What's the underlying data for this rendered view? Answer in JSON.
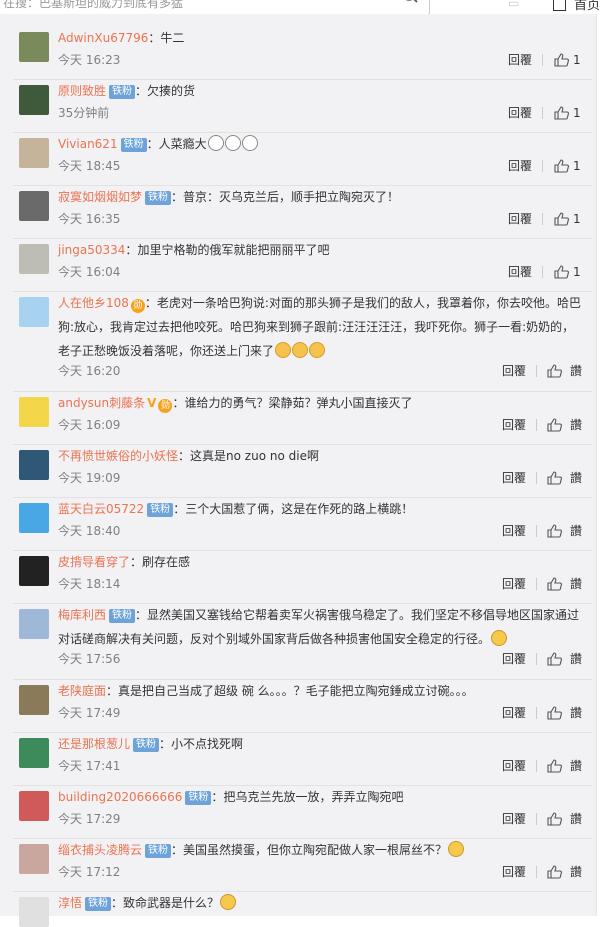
{
  "header": {
    "search_text": "在搜：巴基斯坦的威力到底有多猛",
    "home_label": "首页"
  },
  "comments": [
    {
      "name": "AdwinXu67796",
      "badge": "",
      "extra": "",
      "text": "牛二",
      "time": "今天 16:23",
      "reply": "回覆",
      "likes": "1",
      "avatar": "#7a8a5a"
    },
    {
      "name": "原则致胜",
      "badge": "铁粉",
      "extra": "",
      "text": "欠揍的货",
      "time": "35分钟前",
      "reply": "回覆",
      "likes": "1",
      "avatar": "#3e5a3a"
    },
    {
      "name": "Vivian621",
      "badge": "铁粉",
      "extra": "",
      "text": "人菜瘾大",
      "time": "今天 18:45",
      "reply": "回覆",
      "likes": "1",
      "avatar": "#c6b49a",
      "emoji": [
        "face",
        "face",
        "face"
      ]
    },
    {
      "name": "寂寞如烟烟如梦",
      "badge": "铁粉",
      "extra": "",
      "text": "普京：灭乌克兰后，顺手把立陶宛灭了！",
      "time": "今天 16:35",
      "reply": "回覆",
      "likes": "1",
      "avatar": "#6a6a6a"
    },
    {
      "name": "jinga50334",
      "badge": "",
      "extra": "",
      "text": "加里宁格勒的俄军就能把丽丽平了吧",
      "time": "今天 16:04",
      "reply": "回覆",
      "likes": "1",
      "avatar": "#bdbdb5"
    },
    {
      "name": "人在他乡108",
      "badge": "",
      "extra": "medal",
      "text": "老虎对一条哈巴狗说:对面的那头狮子是我们的敌人，我罩着你，你去咬他。哈巴狗:放心，我肯定过去把他咬死。哈巴狗来到狮子跟前:汪汪汪汪汪，我吓死你。狮子一看:奶奶的，老子正愁晚饭没着落呢，你还送上门来了",
      "time": "今天 16:20",
      "reply": "回覆",
      "likes": "",
      "like_label": "讚",
      "avatar": "#a8d3f0",
      "emoji": [
        "laugh",
        "laugh",
        "laugh"
      ]
    },
    {
      "name": "andysun刺藤条",
      "badge": "",
      "extra": "vmedal",
      "text": "谁给力的勇气？梁静茹？弹丸小国直接灭了",
      "time": "今天 16:09",
      "reply": "回覆",
      "likes": "",
      "like_label": "讚",
      "avatar": "#f3d64a"
    },
    {
      "name": "不再愤世嫉俗的小妖怪",
      "badge": "",
      "extra": "",
      "text": "这真是no zuo no die啊",
      "time": "今天 19:09",
      "reply": "回覆",
      "likes": "",
      "like_label": "讚",
      "avatar": "#2f5876"
    },
    {
      "name": "蓝天白云05722",
      "badge": "铁粉",
      "extra": "",
      "text": "三个大国惹了俩，这是在作死的路上横跳！",
      "time": "今天 18:40",
      "reply": "回覆",
      "likes": "",
      "like_label": "讚",
      "avatar": "#4aa7e6"
    },
    {
      "name": "皮揹导看穿了",
      "badge": "",
      "extra": "",
      "text": "刷存在感",
      "time": "今天 18:14",
      "reply": "回覆",
      "likes": "",
      "like_label": "讚",
      "avatar": "#222222"
    },
    {
      "name": "梅库利西",
      "badge": "铁粉",
      "extra": "",
      "text": "显然美国又塞钱给它帮着卖军火祸害俄乌稳定了。我们坚定不移倡导地区国家通过对话磋商解决有关问题，反对个别域外国家背后做各种损害他国安全稳定的行径。",
      "time": "今天 17:56",
      "reply": "回覆",
      "likes": "",
      "like_label": "讚",
      "avatar": "#9fb8d8",
      "emoji": [
        "yellow"
      ]
    },
    {
      "name": "老陕庭面",
      "badge": "",
      "extra": "",
      "text": "真是把自己当成了超级 碗 么。。。？毛子能把立陶宛錘成立讨碗。。。",
      "time": "今天 17:49",
      "reply": "回覆",
      "likes": "",
      "like_label": "讚",
      "avatar": "#8a7a5a"
    },
    {
      "name": "还是那根葱儿",
      "badge": "铁粉",
      "extra": "",
      "text": "小不点找死啊",
      "time": "今天 17:41",
      "reply": "回覆",
      "likes": "",
      "like_label": "讚",
      "avatar": "#3d8a5a"
    },
    {
      "name": "building2020666666",
      "badge": "铁粉",
      "extra": "",
      "text": "把乌克兰先放一放，弄弄立陶宛吧",
      "time": "今天 17:29",
      "reply": "回覆",
      "likes": "",
      "like_label": "讚",
      "avatar": "#d05a5a"
    },
    {
      "name": "缁衣捕头凌腾云",
      "badge": "铁粉",
      "extra": "",
      "text": "美国虽然摸蛋，但你立陶宛配做人家一根屌丝不？",
      "time": "今天 17:12",
      "reply": "回覆",
      "likes": "",
      "like_label": "讚",
      "avatar": "#c9a79e",
      "emoji": [
        "yellow"
      ]
    },
    {
      "name": "淳悟",
      "badge": "铁粉",
      "extra": "",
      "text": "致命武器是什么？",
      "time": "",
      "reply": "",
      "likes": "",
      "like_label": "",
      "avatar": "#e0e0e0",
      "emoji": [
        "yellow"
      ]
    }
  ]
}
